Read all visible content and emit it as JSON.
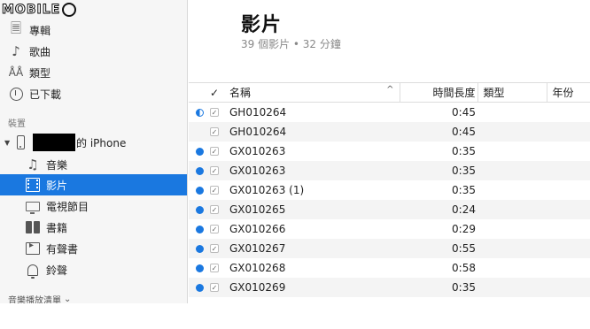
{
  "logo": {
    "text": "MOBILE"
  },
  "sidebar": {
    "library_items": [
      {
        "label": "專輯",
        "icon": "album-icon"
      },
      {
        "label": "歌曲",
        "icon": "music-note-icon"
      },
      {
        "label": "類型",
        "icon": "genre-icon"
      },
      {
        "label": "已下載",
        "icon": "download-clock-icon"
      }
    ],
    "devices_heading": "裝置",
    "device_name": "的 iPhone",
    "device_items": [
      {
        "label": "音樂",
        "icon": "music-note-icon"
      },
      {
        "label": "影片",
        "icon": "film-icon"
      },
      {
        "label": "電視節目",
        "icon": "tv-icon"
      },
      {
        "label": "書籍",
        "icon": "book-icon"
      },
      {
        "label": "有聲書",
        "icon": "audiobook-icon"
      },
      {
        "label": "鈴聲",
        "icon": "bell-icon"
      }
    ],
    "playlists_heading": "音樂播放清單",
    "playlists_chevron": "⌄"
  },
  "main": {
    "title": "影片",
    "subtitle": "39 個影片 • 32 分鐘",
    "columns": {
      "check": "✓",
      "name": "名稱",
      "sort_indicator": "^",
      "time": "時間長度",
      "genre": "類型",
      "year": "年份"
    },
    "rows": [
      {
        "status": "half",
        "checked": true,
        "name": "GH010264",
        "time": "0:45"
      },
      {
        "status": "none",
        "checked": true,
        "name": "GH010264",
        "time": "0:45"
      },
      {
        "status": "full",
        "checked": true,
        "name": "GX010263",
        "time": "0:35"
      },
      {
        "status": "full",
        "checked": true,
        "name": "GX010263",
        "time": "0:35"
      },
      {
        "status": "full",
        "checked": true,
        "name": "GX010263 (1)",
        "time": "0:35"
      },
      {
        "status": "full",
        "checked": true,
        "name": "GX010265",
        "time": "0:24"
      },
      {
        "status": "full",
        "checked": true,
        "name": "GX010266",
        "time": "0:29"
      },
      {
        "status": "full",
        "checked": true,
        "name": "GX010267",
        "time": "0:55"
      },
      {
        "status": "full",
        "checked": true,
        "name": "GX010268",
        "time": "0:58"
      },
      {
        "status": "full",
        "checked": true,
        "name": "GX010269",
        "time": "0:35"
      }
    ],
    "accent_color": "#1a78e0"
  }
}
